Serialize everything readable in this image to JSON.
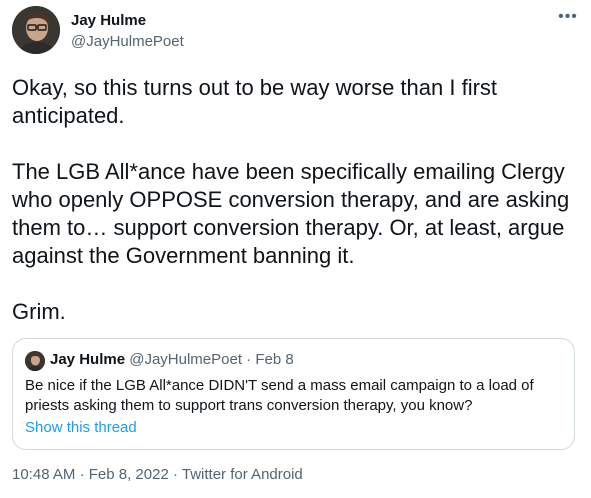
{
  "author": {
    "name": "Jay Hulme",
    "handle": "@JayHulmePoet"
  },
  "more_icon": "more-horizontal-icon",
  "tweet": {
    "paragraphs": [
      "Okay, so this turns out to be way worse than I first anticipated.",
      "The LGB All*ance have been specifically emailing Clergy who openly OPPOSE conversion therapy, and are asking them to… support conversion therapy. Or, at least, argue against the Government banning it.",
      "Grim."
    ]
  },
  "quote": {
    "name": "Jay Hulme",
    "handle": "@JayHulmePoet",
    "separator": "·",
    "date": "Feb 8",
    "text": "Be nice if the LGB All*ance DIDN'T send a mass email campaign to a load of priests asking them to support trans conversion therapy, you know?",
    "show_thread": "Show this thread"
  },
  "meta": {
    "time": "10:48 AM",
    "separator": "·",
    "date": "Feb 8, 2022",
    "source": "Twitter for Android"
  },
  "colors": {
    "text": "#0f1419",
    "secondary": "#536471",
    "link": "#1d9bf0",
    "border": "#cfd9de"
  }
}
